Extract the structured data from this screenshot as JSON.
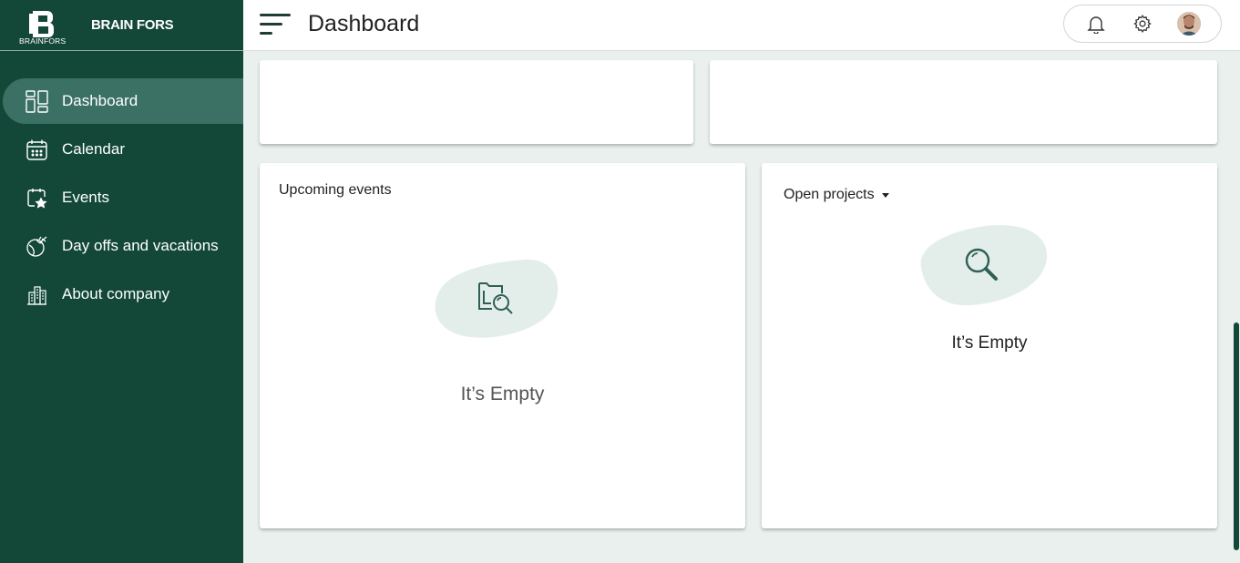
{
  "brand": {
    "name": "BRAIN FORS",
    "logo_text": "BRAINFORS"
  },
  "colors": {
    "sidebar": "#134839",
    "active": "#3b7164",
    "accent": "#1f5a4c",
    "blob": "#e3eeeb",
    "page_bg": "#e9f0ee"
  },
  "nav": {
    "items": [
      {
        "label": "Dashboard",
        "icon": "dashboard-icon",
        "active": true
      },
      {
        "label": "Calendar",
        "icon": "calendar-icon",
        "active": false
      },
      {
        "label": "Events",
        "icon": "event-star-icon",
        "active": false
      },
      {
        "label": "Day offs and vacations",
        "icon": "globe-plane-icon",
        "active": false
      },
      {
        "label": "About company",
        "icon": "buildings-icon",
        "active": false
      }
    ]
  },
  "header": {
    "title": "Dashboard",
    "icons": [
      "bell-icon",
      "gear-icon",
      "avatar"
    ]
  },
  "cards": {
    "upcoming": {
      "title": "Upcoming events",
      "empty_text": "It’s Empty",
      "icon": "folder-search-icon"
    },
    "projects": {
      "title": "Open projects",
      "empty_text": "It’s Empty",
      "icon": "magnifier-icon"
    }
  }
}
